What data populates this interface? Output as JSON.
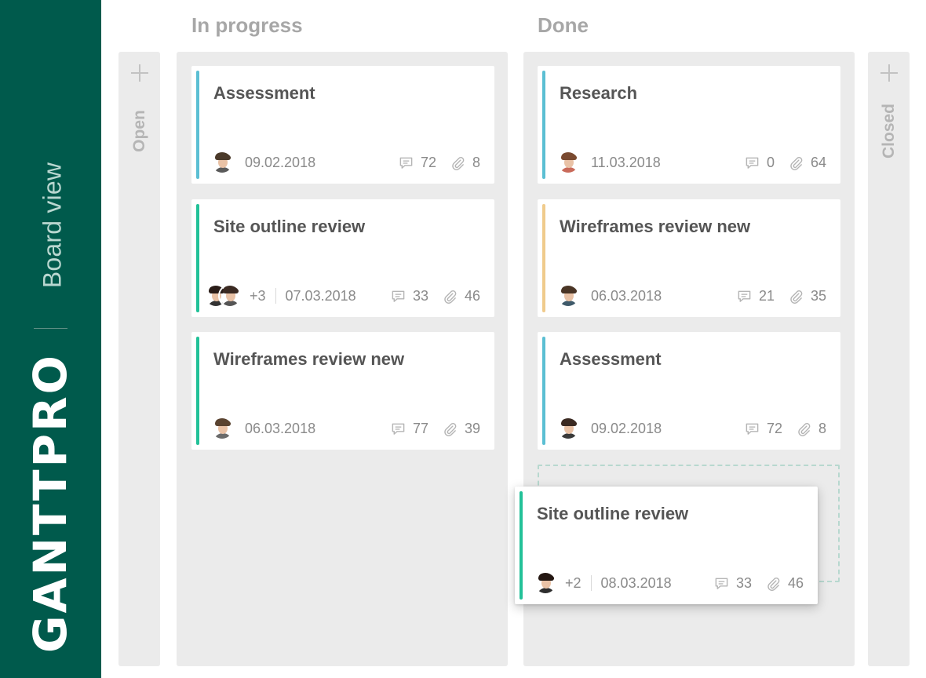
{
  "brand": {
    "view_label": "Board view",
    "logo_text": "GANTTPRO"
  },
  "columns": {
    "open": {
      "label": "Open"
    },
    "in_progress": {
      "heading": "In progress"
    },
    "done": {
      "heading": "Done"
    },
    "closed": {
      "label": "Closed"
    }
  },
  "colors": {
    "brand": "#005a4c",
    "blue": "#5bbfd3",
    "green": "#22c198",
    "yellow": "#f0cb8c",
    "lane": "#ebebeb"
  },
  "cards": {
    "ip1": {
      "title": "Assessment",
      "date": "09.02.2018",
      "comments": "72",
      "attachments": "8",
      "accent": "blue"
    },
    "ip2": {
      "title": "Site outline review",
      "extra": "+3",
      "date": "07.03.2018",
      "comments": "33",
      "attachments": "46",
      "accent": "green"
    },
    "ip3": {
      "title": "Wireframes review  new",
      "date": "06.03.2018",
      "comments": "77",
      "attachments": "39",
      "accent": "green"
    },
    "d1": {
      "title": "Research",
      "date": "11.03.2018",
      "comments": "0",
      "attachments": "64",
      "accent": "blue"
    },
    "d2": {
      "title": "Wireframes review  new",
      "date": "06.03.2018",
      "comments": "21",
      "attachments": "35",
      "accent": "yellow"
    },
    "d3": {
      "title": "Assessment",
      "date": "09.02.2018",
      "comments": "72",
      "attachments": "8",
      "accent": "blue"
    },
    "drag": {
      "title": "Site outline review",
      "extra": "+2",
      "date": "08.03.2018",
      "comments": "33",
      "attachments": "46",
      "accent": "green"
    }
  }
}
